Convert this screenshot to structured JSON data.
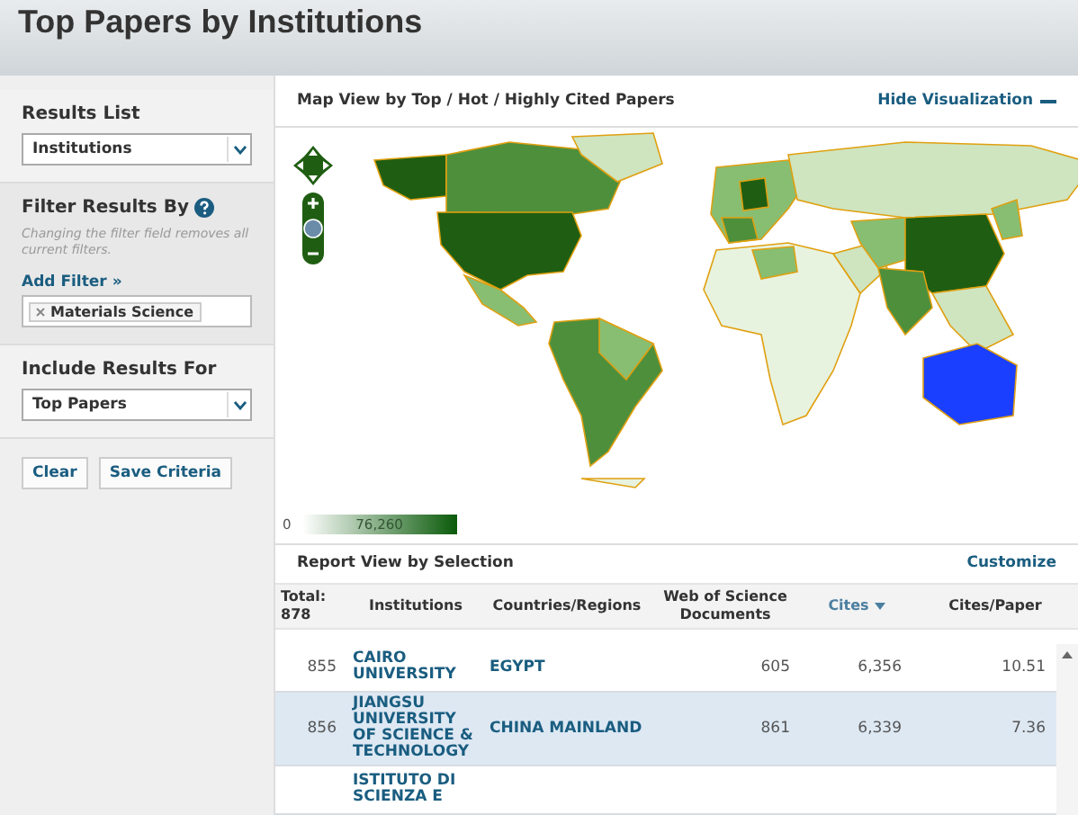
{
  "page_title": "Top Papers by Institutions",
  "sidebar": {
    "sections": [
      {
        "kind": "select",
        "label": "Results List",
        "value": "Institutions"
      },
      {
        "kind": "filter",
        "label": "Filter Results By",
        "note": "Changing the filter field removes all current filters.",
        "link": "Add Filter »",
        "tags": [
          "Materials Science"
        ]
      },
      {
        "kind": "select",
        "label": "Include Results For",
        "value": "Top Papers"
      }
    ],
    "buttons": [
      "Clear",
      "Save Criteria"
    ]
  },
  "map": {
    "title": "Map View by Top / Hot / Highly Cited Papers",
    "hide_link": "Hide Visualization",
    "legend_min": "0",
    "legend_max": "76,260"
  },
  "report": {
    "title": "Report View by Selection",
    "customize": "Customize",
    "columns": [
      {
        "label": "Total: 878",
        "sorted": false
      },
      {
        "label": "Institutions",
        "sorted": false
      },
      {
        "label": "Countries/Regions",
        "sorted": false
      },
      {
        "label": "Web of Science Documents",
        "sorted": false
      },
      {
        "label": "Cites",
        "sorted": true
      },
      {
        "label": "Cites/Paper",
        "sorted": false
      }
    ],
    "rows": [
      {
        "rank": "855",
        "institution": "CAIRO UNIVERSITY",
        "country": "EGYPT",
        "documents": "605",
        "cites": "6,356",
        "cites_per_paper": "10.51",
        "selected": false
      },
      {
        "rank": "856",
        "institution": "JIANGSU UNIVERSITY OF SCIENCE & TECHNOLOGY",
        "country": "CHINA MAINLAND",
        "documents": "861",
        "cites": "6,339",
        "cites_per_paper": "7.36",
        "selected": true
      },
      {
        "institution": "ISTITUTO DI SCIENZA E",
        "selected": false
      }
    ]
  }
}
